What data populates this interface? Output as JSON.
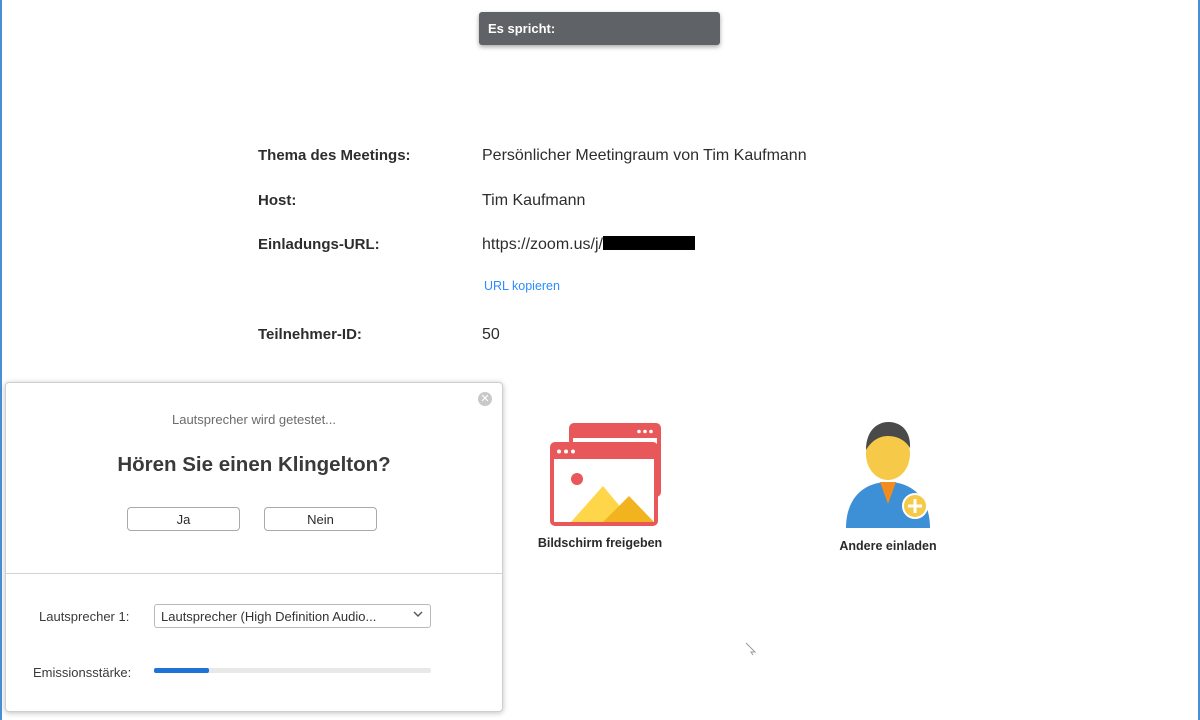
{
  "speaking_banner": {
    "label": "Es spricht:"
  },
  "meeting_info": {
    "topic_label": "Thema des Meetings:",
    "topic_value": "Persönlicher Meetingraum von Tim Kaufmann",
    "host_label": "Host:",
    "host_value": "Tim Kaufmann",
    "invite_url_label": "Einladungs-URL:",
    "invite_url_value": "https://zoom.us/j/",
    "copy_url_label": "URL kopieren",
    "participant_id_label": "Teilnehmer-ID:",
    "participant_id_value": "50"
  },
  "actions": [
    {
      "label": "Bildschirm freigeben",
      "icon": "share-screen-icon"
    },
    {
      "label": "Andere einladen",
      "icon": "invite-user-icon"
    }
  ],
  "speaker_test_dialog": {
    "status": "Lautsprecher wird getestet...",
    "question": "Hören Sie einen Klingelton?",
    "yes_label": "Ja",
    "no_label": "Nein",
    "speaker_label": "Lautsprecher 1:",
    "speaker_selected": "Lautsprecher (High Definition Audio...",
    "output_level_label": "Emissionsstärke:",
    "output_level": 0.2
  },
  "colors": {
    "banner_bg": "#5f6266",
    "link": "#2d8cff",
    "level_fill": "#1f73d6",
    "share_icon": "#e8575a",
    "invite_icon": "#3d8fd6"
  }
}
